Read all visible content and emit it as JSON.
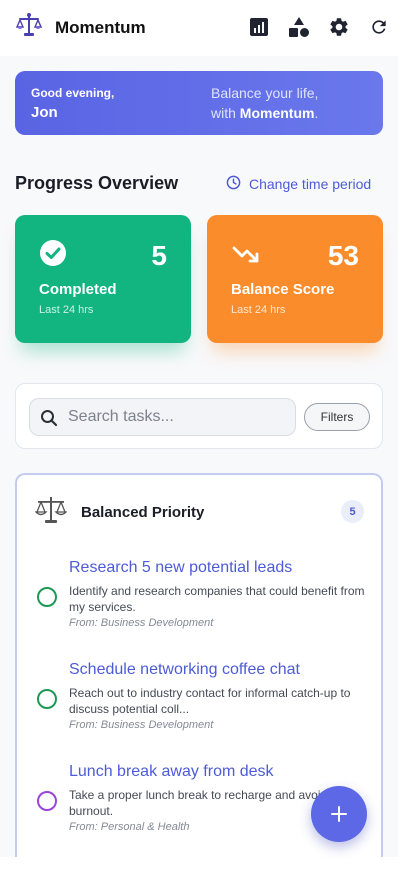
{
  "app": {
    "title": "Momentum"
  },
  "header_actions": [
    {
      "icon": "chart-icon"
    },
    {
      "icon": "shapes-icon"
    },
    {
      "icon": "gear-icon"
    },
    {
      "icon": "refresh-icon"
    }
  ],
  "banner": {
    "greeting": "Good evening,",
    "name": "Jon",
    "tagline_line1": "Balance your life,",
    "tagline_prefix": "with ",
    "tagline_brand": "Momentum",
    "tagline_suffix": "."
  },
  "progress": {
    "title": "Progress Overview",
    "change_period": "Change time period",
    "stats": [
      {
        "value": "5",
        "label": "Completed",
        "sub": "Last 24 hrs",
        "icon": "check-circle-icon",
        "color": "#12b57f"
      },
      {
        "value": "53",
        "label": "Balance Score",
        "sub": "Last 24 hrs",
        "icon": "trending-down-icon",
        "color": "#fb8c2c"
      }
    ]
  },
  "search": {
    "placeholder": "Search tasks...",
    "filters_label": "Filters"
  },
  "task_group": {
    "title": "Balanced Priority",
    "count": "5",
    "icon": "scales-icon",
    "tasks": [
      {
        "title": "Research 5 new potential leads",
        "description": "Identify and research companies that could benefit from my services.",
        "from": "From: Business Development",
        "color": "#1c9a55"
      },
      {
        "title": "Schedule networking coffee chat",
        "description": "Reach out to industry contact for informal catch-up to discuss potential coll...",
        "from": "From: Business Development",
        "color": "#1c9a55"
      },
      {
        "title": "Lunch break away from desk",
        "description": "Take a proper lunch break to recharge and avoid burnout.",
        "from": "From: Personal & Health",
        "color": "#9a44db"
      }
    ]
  },
  "colors": {
    "accent": "#4d5bd6",
    "fab": "#5c68e6"
  }
}
